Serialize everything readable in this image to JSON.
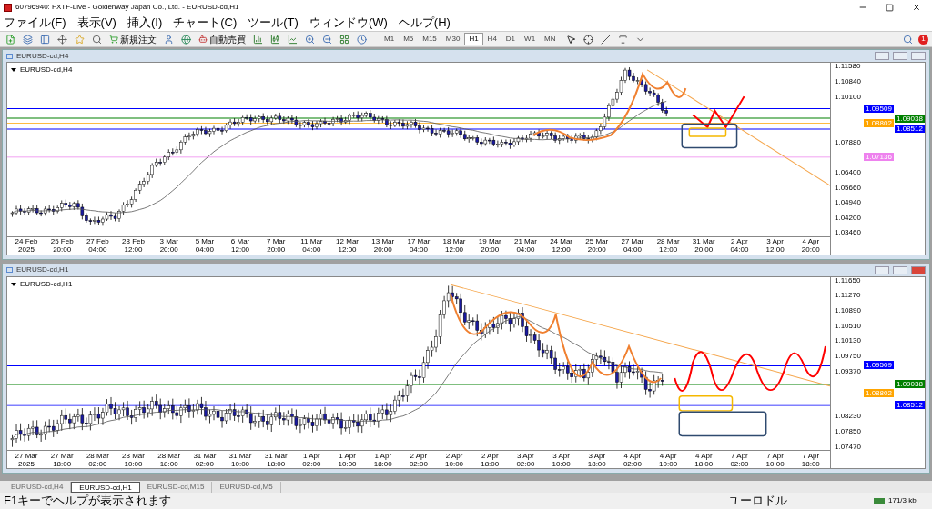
{
  "window": {
    "title": "60796940: FXTF-Live - Goldenway Japan Co., Ltd. - EURUSD-cd,H1"
  },
  "menu": [
    "ファイル(F)",
    "表示(V)",
    "挿入(I)",
    "チャート(C)",
    "ツール(T)",
    "ウィンドウ(W)",
    "ヘルプ(H)"
  ],
  "toolbar": {
    "order_button": "新規注文",
    "auto_trade_button": "自動売買",
    "alerts": "1"
  },
  "timeframes": [
    {
      "label": "M1",
      "selected": false
    },
    {
      "label": "M5",
      "selected": false
    },
    {
      "label": "M15",
      "selected": false
    },
    {
      "label": "M30",
      "selected": false
    },
    {
      "label": "H1",
      "selected": true
    },
    {
      "label": "H4",
      "selected": false
    },
    {
      "label": "D1",
      "selected": false
    },
    {
      "label": "W1",
      "selected": false
    },
    {
      "label": "MN",
      "selected": false
    }
  ],
  "charts": [
    {
      "title": "EURUSD-cd,H4",
      "label": "EURUSD-cd,H4",
      "active": false,
      "y_labels": [
        "1.11580",
        "1.10840",
        "1.10100",
        "1.07880",
        "1.06400",
        "1.05660",
        "1.04940",
        "1.04200",
        "1.03460"
      ],
      "x_labels": [
        "24 Feb 2025",
        "25 Feb 20:00",
        "27 Feb 04:00",
        "28 Feb 12:00",
        "3 Mar 20:00",
        "5 Mar 04:00",
        "6 Mar 12:00",
        "7 Mar 20:00",
        "11 Mar 04:00",
        "12 Mar 12:00",
        "13 Mar 20:00",
        "17 Mar 04:00",
        "18 Mar 12:00",
        "19 Mar 20:00",
        "21 Mar 04:00",
        "24 Mar 12:00",
        "25 Mar 20:00",
        "27 Mar 04:00",
        "28 Mar 12:00",
        "31 Mar 20:00",
        "2 Apr 04:00",
        "3 Apr 12:00",
        "4 Apr 20:00"
      ],
      "price_tags": [
        {
          "text": "1.09509",
          "color": "#0000ff"
        },
        {
          "text": "1.09038",
          "color": "#008000"
        },
        {
          "text": "1.08802",
          "color": "#ffa500"
        },
        {
          "text": "1.08512",
          "color": "#0000ff"
        },
        {
          "text": "1.07136",
          "color": "#ee82ee"
        }
      ]
    },
    {
      "title": "EURUSD-cd,H1",
      "label": "EURUSD-cd,H1",
      "active": true,
      "y_labels": [
        "1.11650",
        "1.11270",
        "1.10890",
        "1.10510",
        "1.10130",
        "1.09750",
        "1.09370",
        "1.08230",
        "1.07850",
        "1.07470"
      ],
      "x_labels": [
        "27 Mar 2025",
        "27 Mar 18:00",
        "28 Mar 02:00",
        "28 Mar 10:00",
        "28 Mar 18:00",
        "31 Mar 02:00",
        "31 Mar 10:00",
        "31 Mar 18:00",
        "1 Apr 02:00",
        "1 Apr 10:00",
        "1 Apr 18:00",
        "2 Apr 02:00",
        "2 Apr 10:00",
        "2 Apr 18:00",
        "3 Apr 02:00",
        "3 Apr 10:00",
        "3 Apr 18:00",
        "4 Apr 02:00",
        "4 Apr 10:00",
        "4 Apr 18:00",
        "7 Apr 02:00",
        "7 Apr 10:00",
        "7 Apr 18:00"
      ],
      "price_tags": [
        {
          "text": "1.09509",
          "color": "#0000ff"
        },
        {
          "text": "1.09038",
          "color": "#008000"
        },
        {
          "text": "1.08802",
          "color": "#ffa500"
        },
        {
          "text": "1.08512",
          "color": "#0000ff"
        }
      ]
    }
  ],
  "tabs": [
    {
      "label": "EURUSD-cd,H4",
      "selected": false
    },
    {
      "label": "EURUSD-cd,H1",
      "selected": true
    },
    {
      "label": "EURUSD-cd,M15",
      "selected": false
    },
    {
      "label": "EURUSD-cd,M5",
      "selected": false
    }
  ],
  "status_bar": {
    "hint": "F1キーでヘルプが表示されます",
    "symbol": "ユーロドル",
    "traffic": "171/3 kb"
  }
}
